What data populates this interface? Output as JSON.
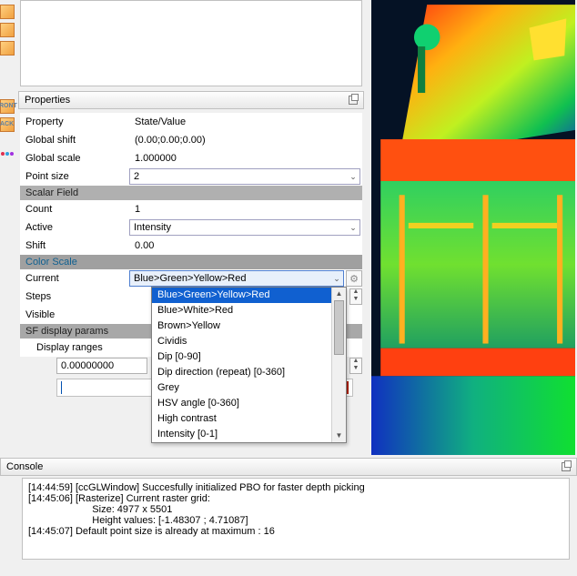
{
  "left_icons": {
    "front_label": "RONT",
    "back_label": "ACK"
  },
  "properties": {
    "title": "Properties",
    "cols": {
      "property": "Property",
      "value": "State/Value"
    },
    "global_shift": {
      "label": "Global shift",
      "value": "(0.00;0.00;0.00)"
    },
    "global_scale": {
      "label": "Global scale",
      "value": "1.000000"
    },
    "point_size": {
      "label": "Point size",
      "value": "2"
    },
    "scalar_field": {
      "title": "Scalar Field",
      "count": {
        "label": "Count",
        "value": "1"
      },
      "active": {
        "label": "Active",
        "value": "Intensity"
      },
      "shift": {
        "label": "Shift",
        "value": "0.00"
      }
    },
    "color_scale": {
      "title": "Color Scale",
      "current": {
        "label": "Current",
        "value": "Blue>Green>Yellow>Red"
      },
      "steps": {
        "label": "Steps"
      },
      "visible": {
        "label": "Visible"
      },
      "options": [
        "Blue>Green>Yellow>Red",
        "Blue>White>Red",
        "Brown>Yellow",
        "Cividis",
        "Dip [0-90]",
        "Dip direction (repeat) [0-360]",
        "Grey",
        "HSV angle [0-360]",
        "High contrast",
        "Intensity [0-1]"
      ],
      "selected_index": 0
    },
    "sf_display": {
      "title": "SF display params",
      "display_ranges": {
        "label": "Display ranges"
      },
      "value": "0.00000000"
    }
  },
  "console": {
    "title": "Console",
    "lines": [
      "[14:44:59] [ccGLWindow] Succesfully initialized PBO for faster depth picking",
      "[14:45:06] [Rasterize] Current raster grid:",
      "                       Size: 4977 x 5501",
      "                       Height values: [-1.48307 ; 4.71087]",
      "[14:45:07] Default point size is already at maximum : 16"
    ]
  }
}
